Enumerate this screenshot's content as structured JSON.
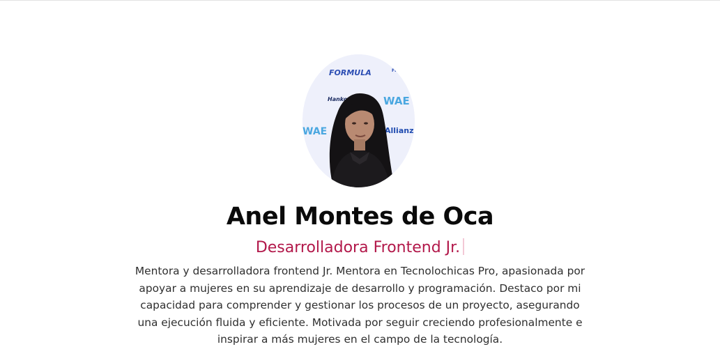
{
  "profile": {
    "avatar": {
      "alt": "Anel Montes de Oca",
      "backdrop_logos": [
        "FORMULA",
        "Hankook",
        "WAE",
        "Allianz",
        "FIA"
      ]
    },
    "name": "Anel Montes de Oca",
    "role": "Desarrolladora Frontend Jr.",
    "bio": "Mentora y desarrolladora frontend Jr. Mentora en Tecnolochicas Pro, apasionada por apoyar a mujeres en su aprendizaje de desarrollo y programación. Destaco por mi capacidad para comprender y gestionar los procesos de un proyecto, asegurando una ejecución fluida y eficiente. Motivada por seguir creciendo profesionalmente e inspirar a más mujeres en el campo de la tecnología."
  },
  "colors": {
    "name": "#0a0a0a",
    "role": "#b2184a",
    "bio": "#2f2f2f",
    "backdrop": "#eef0fb",
    "backdrop_text": "#2b4db3"
  }
}
